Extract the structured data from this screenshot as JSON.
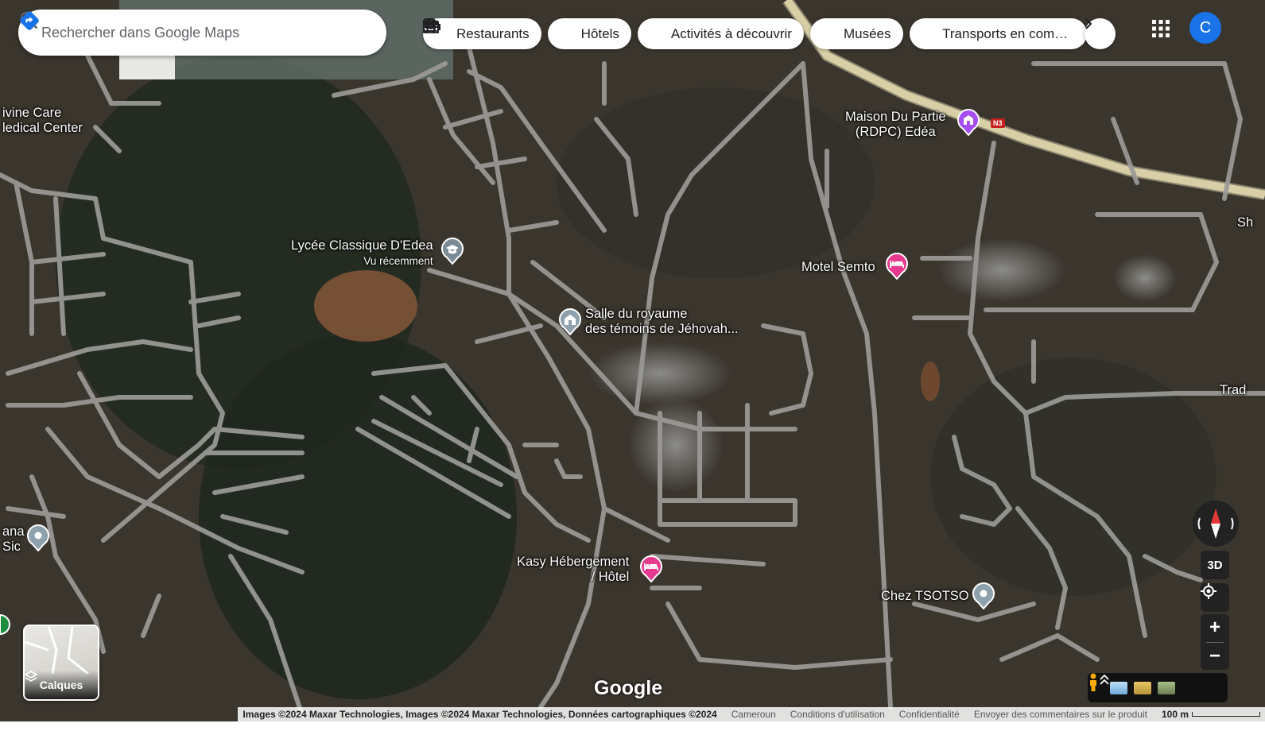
{
  "search": {
    "placeholder": "Rechercher dans Google Maps"
  },
  "chips": [
    {
      "label": "Restaurants",
      "icon": "restaurant-icon"
    },
    {
      "label": "Hôtels",
      "icon": "hotel-icon"
    },
    {
      "label": "Activités à découvrir",
      "icon": "camera-icon"
    },
    {
      "label": "Musées",
      "icon": "museum-icon"
    },
    {
      "label": "Transports en comm...",
      "icon": "bus-icon"
    }
  ],
  "account": {
    "initial": "C",
    "color": "#1a73e8"
  },
  "places": {
    "divine_care": {
      "line1": "ivine Care",
      "line2": "ledical Center"
    },
    "lycee": {
      "name": "Lycée Classique D'Edea",
      "note": "Vu récemment"
    },
    "salle": {
      "line1": "Salle du royaume",
      "line2": "des témoins de Jéhovah..."
    },
    "maison": {
      "line1": "Maison Du Partie",
      "line2": "(RDPC) Edéa"
    },
    "motel": {
      "name": "Motel Semto"
    },
    "kasy": {
      "line1": "Kasy Hébergement",
      "line2": "/ Hôtel"
    },
    "tsotso": {
      "name": "Chez TSOTSO"
    },
    "ana": {
      "line1": "ana",
      "line2": "Sic"
    },
    "trad": {
      "name": "Trad"
    },
    "sh": {
      "name": "Sh"
    }
  },
  "road_badge": "N3",
  "layers": {
    "label": "Calques"
  },
  "controls": {
    "three_d": "3D"
  },
  "logo": "Google",
  "footer": {
    "attribution": "Images ©2024 Maxar Technologies, Images ©2024 Maxar Technologies, Données cartographiques ©2024",
    "country": "Cameroun",
    "terms": "Conditions d'utilisation",
    "privacy": "Confidentialité",
    "feedback": "Envoyer des commentaires sur le produit",
    "scale": "100 m"
  },
  "colors": {
    "road": "#9b9a97",
    "hotel_pin": "#e7398e",
    "poi_pin": "#8fa1ad",
    "edu_pin": "#7a8b96",
    "civic_pin": "#a64ef2",
    "highway": "#d8cfa6"
  }
}
